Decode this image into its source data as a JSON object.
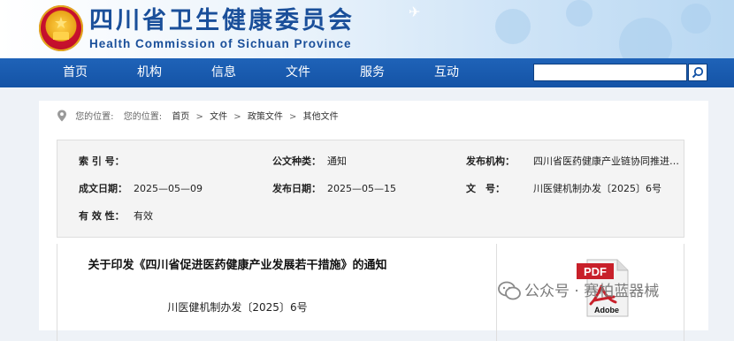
{
  "header": {
    "title": "四川省卫生健康委员会",
    "subtitle": "Health Commission of Sichuan Province"
  },
  "nav": {
    "items": [
      "首页",
      "机构",
      "信息",
      "文件",
      "服务",
      "互动"
    ],
    "search_placeholder": ""
  },
  "breadcrumb": {
    "prefix1": "您的位置:",
    "prefix2": "您的位置:",
    "items": [
      "首页",
      "文件",
      "政策文件",
      "其他文件"
    ],
    "separator": ">"
  },
  "meta": {
    "index_label": "索 引 号：",
    "index_value": "",
    "type_label": "公文种类：",
    "type_value": "通知",
    "issuer_label": "发布机构：",
    "issuer_value": "四川省医药健康产业链协同推进…",
    "created_label": "成文日期：",
    "created_value": "2025—05—09",
    "published_label": "发布日期：",
    "published_value": "2025—05—15",
    "docno_label": "文　号：",
    "docno_value": "川医健机制办发〔2025〕6号",
    "validity_label": "有 效 性：",
    "validity_value": "有效"
  },
  "document": {
    "title": "关于印发《四川省促进医药健康产业发展若干措施》的通知",
    "number": "川医健机制办发〔2025〕6号"
  },
  "pdf": {
    "label_top": "PDF",
    "label_bottom": "Adobe"
  },
  "watermark": {
    "text": "公众号 · 赛柏蓝器械"
  },
  "colors": {
    "nav_blue": "#1453a6",
    "title_blue": "#1a4f9a",
    "pdf_red": "#c8202a"
  }
}
